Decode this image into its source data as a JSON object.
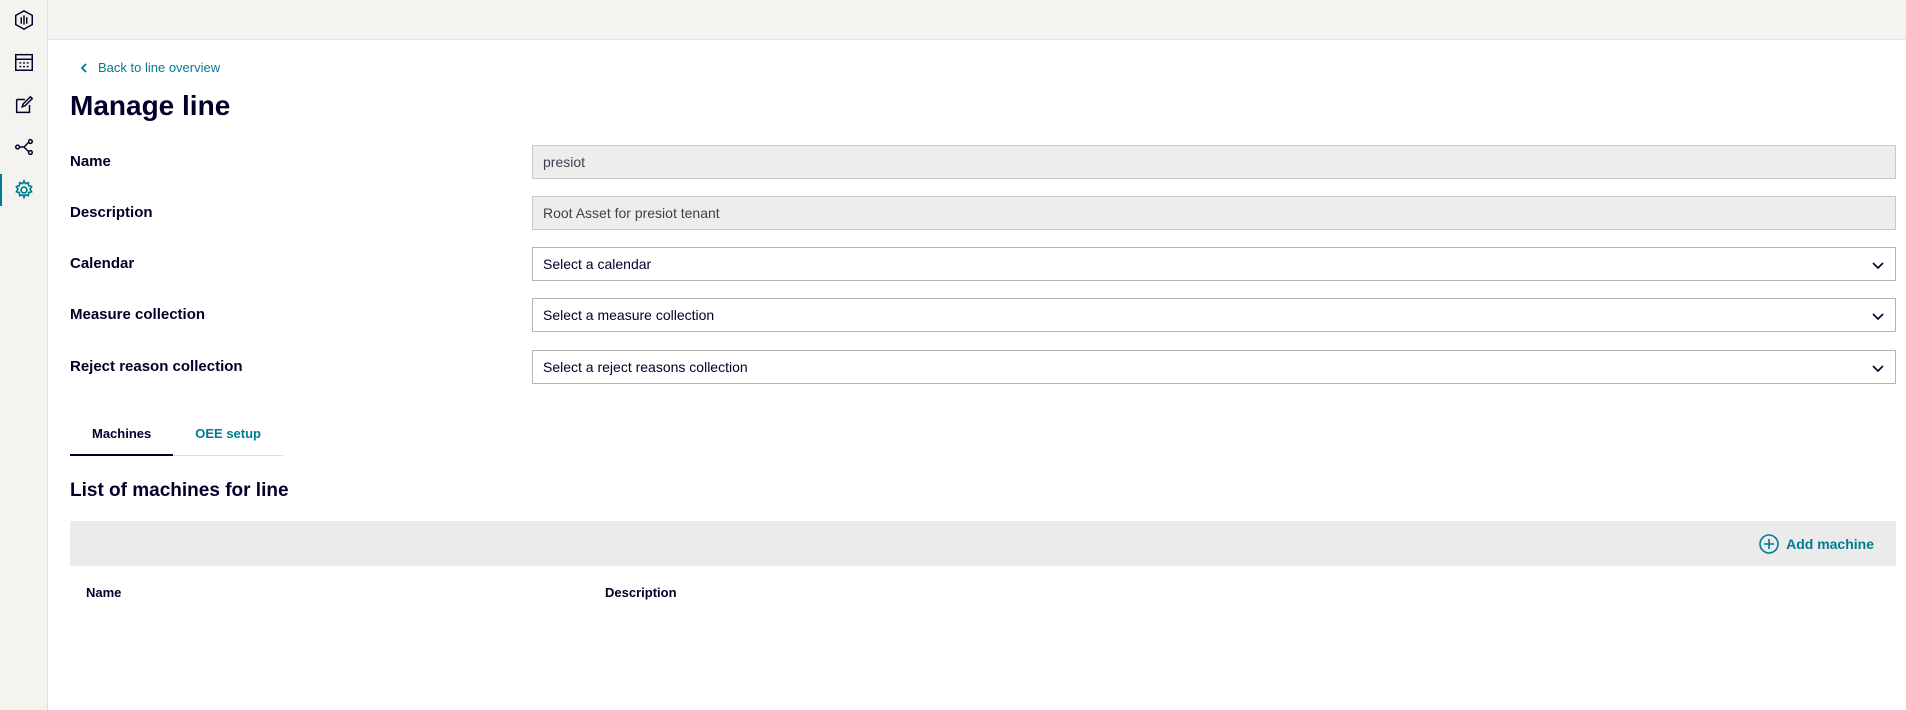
{
  "sidebar": {
    "items": [
      {
        "icon": "app-logo-icon",
        "active": false
      },
      {
        "icon": "calendar-icon",
        "active": false
      },
      {
        "icon": "edit-icon",
        "active": false
      },
      {
        "icon": "share-icon",
        "active": false
      },
      {
        "icon": "gear-icon",
        "active": true
      }
    ]
  },
  "header": {
    "back_link": "Back to line overview",
    "title": "Manage line"
  },
  "form": {
    "name_label": "Name",
    "name_value": "presiot",
    "description_label": "Description",
    "description_value": "Root Asset for presiot tenant",
    "calendar_label": "Calendar",
    "calendar_value": "Select a calendar",
    "measure_label": "Measure collection",
    "measure_value": "Select a measure collection",
    "reject_label": "Reject reason collection",
    "reject_value": "Select a reject reasons collection"
  },
  "tabs": [
    {
      "label": "Machines",
      "active": true
    },
    {
      "label": "OEE setup",
      "active": false
    }
  ],
  "machines": {
    "section_title": "List of machines for line",
    "add_label": "Add machine",
    "columns": [
      "Name",
      "Description"
    ],
    "rows": []
  },
  "colors": {
    "accent": "#007c91",
    "text": "#000028",
    "sidebar_bg": "#f3f3f0"
  }
}
